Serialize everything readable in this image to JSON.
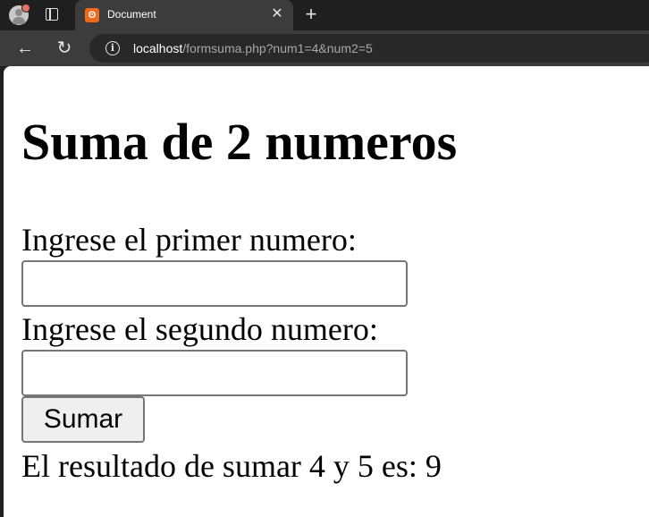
{
  "browser": {
    "tab": {
      "title": "Document",
      "favicon_glyph": "ʘ",
      "close_glyph": "✕"
    },
    "new_tab_glyph": "+",
    "back_glyph": "←",
    "reload_glyph": "↻",
    "address": {
      "host": "localhost",
      "path": "/formsuma.php?num1=4&num2=5"
    },
    "colors": {
      "tab_strip": "#1f1f1f",
      "toolbar": "#3c3c3c",
      "favicon": "#f26b1d"
    }
  },
  "page": {
    "title": "Suma de 2 numeros",
    "label_num1": "Ingrese el primer numero:",
    "label_num2": "Ingrese el segundo numero:",
    "num1_value": "",
    "num2_value": "",
    "submit_label": "Sumar",
    "result_text": "El resultado de sumar 4 y 5 es: 9"
  }
}
